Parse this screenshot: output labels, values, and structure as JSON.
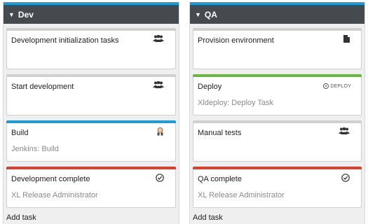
{
  "columns": [
    {
      "name": "Dev",
      "tasks": [
        {
          "title": "Development initialization tasks",
          "subtitle": "",
          "icon": "users-icon",
          "stripe": "#d0d0d0"
        },
        {
          "title": "Start development",
          "subtitle": "",
          "icon": "users-icon",
          "stripe": "#d0d0d0"
        },
        {
          "title": "Build",
          "subtitle": "Jenkins: Build",
          "icon": "jenkins-icon",
          "stripe": "#1a9ed8"
        },
        {
          "title": "Development complete",
          "subtitle": "XL Release Administrator",
          "icon": "check-circle-icon",
          "stripe": "#d9412e"
        }
      ],
      "add_task": "Add task"
    },
    {
      "name": "QA",
      "tasks": [
        {
          "title": "Provision environment",
          "subtitle": "",
          "icon": "document-icon",
          "stripe": "#d0d0d0"
        },
        {
          "title": "Deploy",
          "subtitle": "Xldeploy: Deploy Task",
          "icon": "deploy-logo",
          "logo_text": "DEPLOY",
          "stripe": "#6ab743"
        },
        {
          "title": "Manual tests",
          "subtitle": "",
          "icon": "users-icon",
          "stripe": "#d0d0d0"
        },
        {
          "title": "QA complete",
          "subtitle": "XL Release Administrator",
          "icon": "check-circle-icon",
          "stripe": "#d9412e"
        }
      ],
      "add_task": "Add task"
    }
  ]
}
